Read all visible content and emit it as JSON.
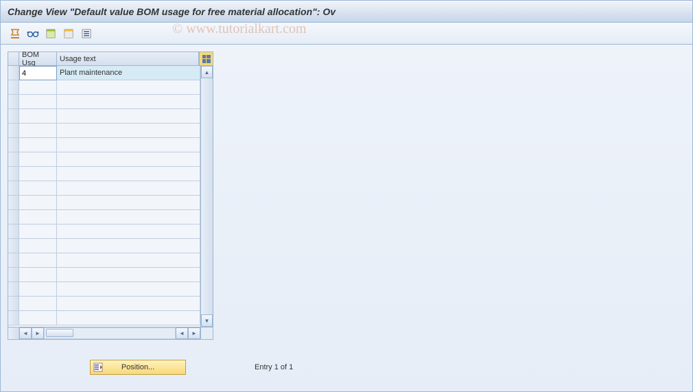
{
  "header": {
    "title": "Change View \"Default value BOM usage for free material allocation\": Ov"
  },
  "toolbar": {
    "icons": [
      "toggle-icon",
      "glasses-icon",
      "new-entries-icon",
      "copy-icon",
      "delimit-icon"
    ]
  },
  "table": {
    "columns": {
      "col1": "BOM Usg",
      "col2": "Usage text"
    },
    "rows": [
      {
        "bom_usg": "4",
        "usage_text": "Plant maintenance"
      }
    ],
    "empty_rows": 17
  },
  "footer": {
    "position_label": "Position...",
    "entry_text": "Entry 1 of 1"
  },
  "watermark": "© www.tutorialkart.com"
}
